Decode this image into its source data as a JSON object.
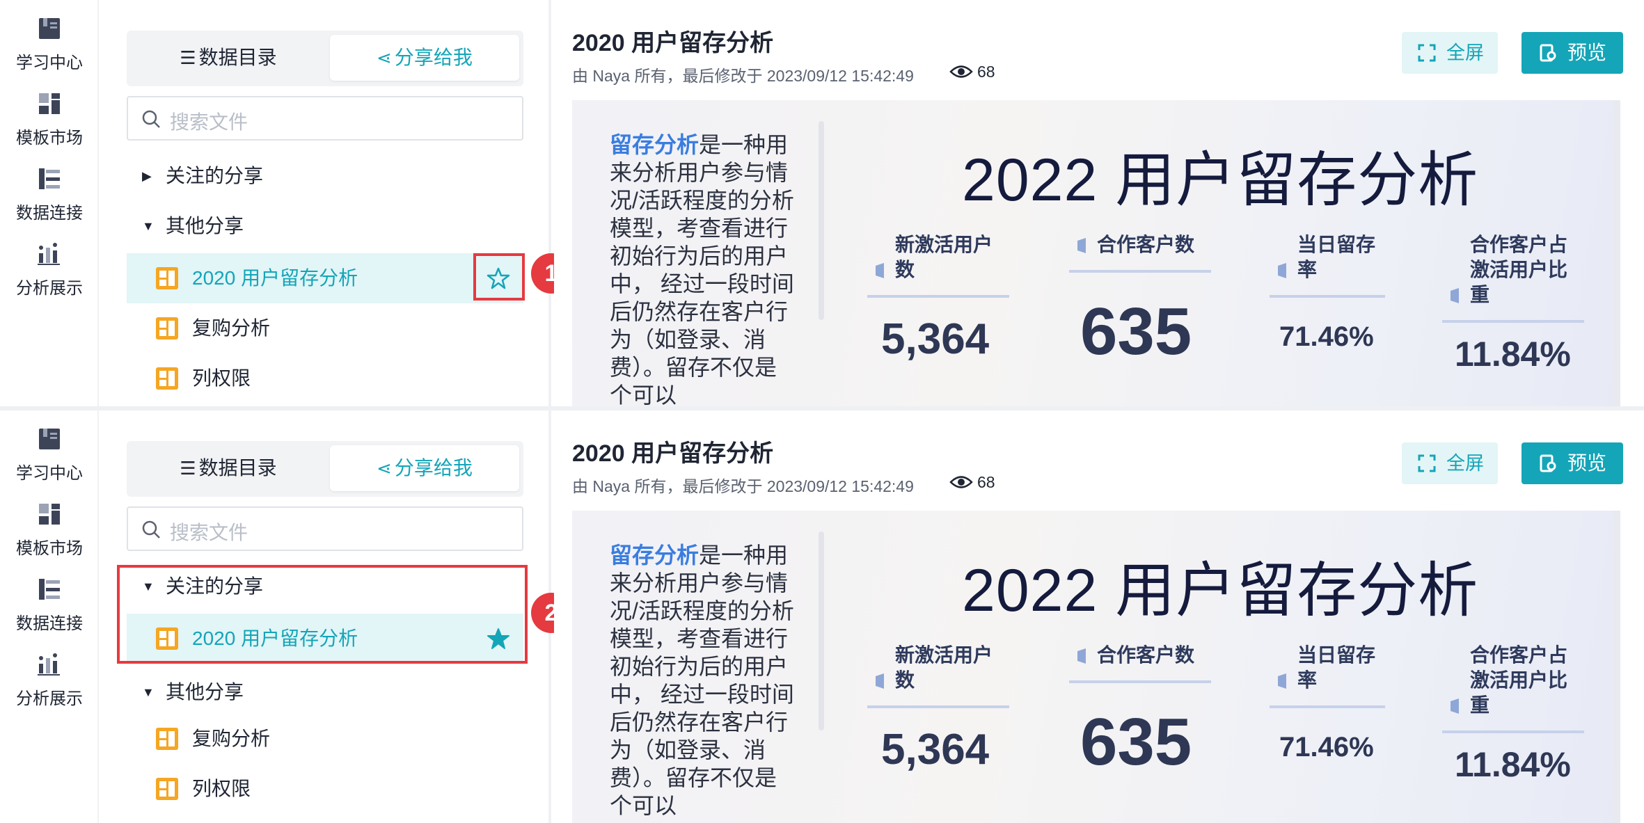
{
  "nav": {
    "items": [
      {
        "label": "学习中心",
        "icon": "book-icon"
      },
      {
        "label": "模板市场",
        "icon": "template-icon"
      },
      {
        "label": "数据连接",
        "icon": "data-connect-icon"
      },
      {
        "label": "分析展示",
        "icon": "chart-icon"
      }
    ]
  },
  "files": {
    "tab_catalog": "数据目录",
    "tab_shared": "分享给我",
    "search_placeholder": "搜索文件",
    "group_followed": "关注的分享",
    "group_other": "其他分享",
    "items": [
      "2020 用户留存分析",
      "复购分析",
      "列权限"
    ]
  },
  "callouts": [
    "1",
    "2"
  ],
  "doc": {
    "title": "2020 用户留存分析",
    "meta": "由 Naya 所有，最后修改于 2023/09/12 15:42:49",
    "views": "68",
    "btn_fullscreen": "全屏",
    "btn_preview": "预览"
  },
  "dashboard": {
    "intro_highlight": "留存分析",
    "intro_text": "是一种用来分析用户参与情况/活跃程度的分析模型，考查看进行初始行为后的用户中， 经过一段时间后仍然存在客户行为（如登录、消费）。留存不仅是个可以",
    "big_title": "2022 用户留存分析",
    "kpis": [
      {
        "label": "新激活用户数",
        "value": "5,364"
      },
      {
        "label": "合作客户数",
        "value": "635"
      },
      {
        "label": "当日留存率",
        "value": "71.46%"
      },
      {
        "label": "合作客户占激活用户比重",
        "value": "11.84%"
      }
    ]
  },
  "colors": {
    "accent": "#14a5b8",
    "highlight": "#e53a40",
    "file_icon": "#f5a623"
  }
}
